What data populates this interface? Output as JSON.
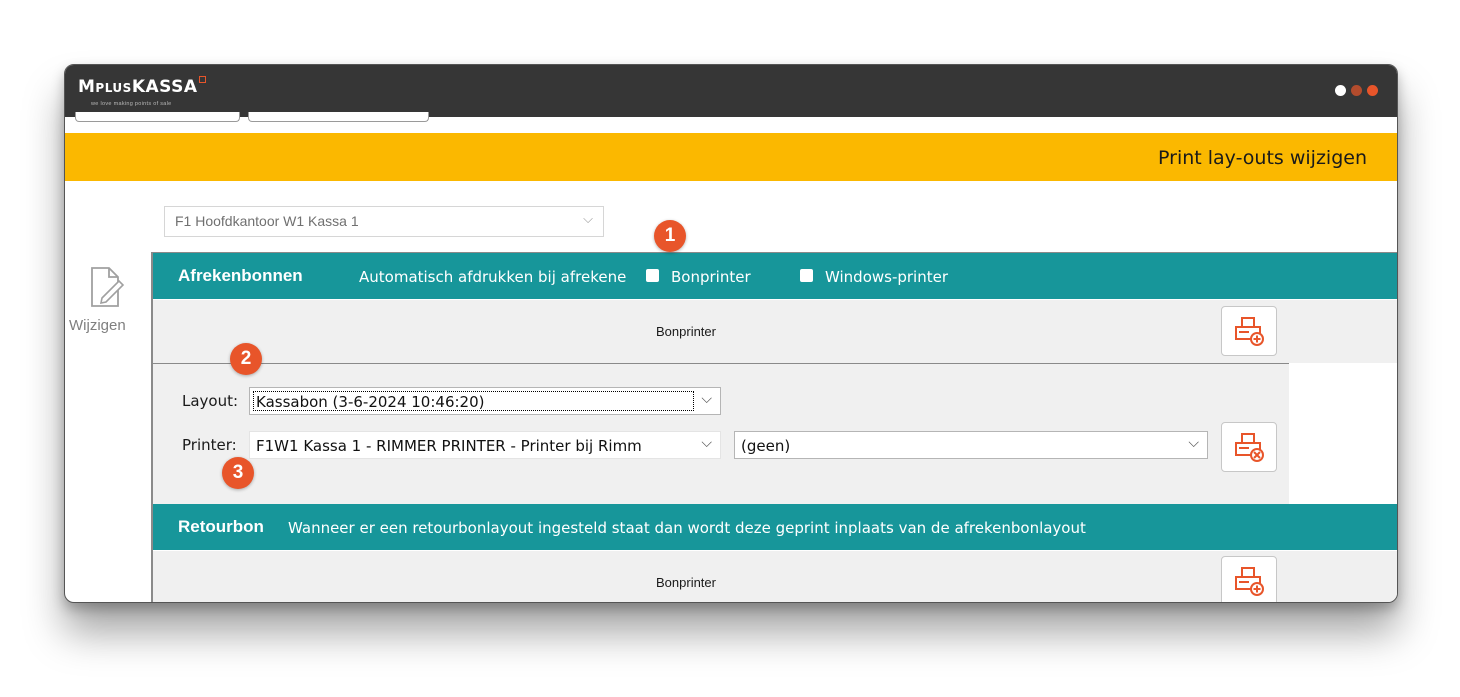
{
  "app": {
    "logo_text": "MPLUSKASSA",
    "tagline": "we love making points of sale",
    "window_dots": [
      "#ffffff",
      "#e8552a",
      "#e8552a"
    ]
  },
  "header": {
    "title": "Print lay-outs wijzigen"
  },
  "store_select": {
    "value": "F1 Hoofdkantoor W1 Kassa 1"
  },
  "sidebar": {
    "edit_label": "Wijzigen"
  },
  "afrekenbonnen": {
    "title": "Afrekenbonnen",
    "auto_print_label": "Automatisch afdrukken bij afrekene",
    "bonprinter_checkbox_label": "Bonprinter",
    "windows_printer_checkbox_label": "Windows-printer",
    "bonprinter_row_label": "Bonprinter",
    "layout_label": "Layout:",
    "layout_value": "Kassabon (3-6-2024 10:46:20)",
    "printer_label": "Printer:",
    "printer_value": "F1W1 Kassa 1 - RIMMER PRINTER - Printer bij Rimm",
    "printer_option_value": "(geen)"
  },
  "retourbon": {
    "title": "Retourbon",
    "description": "Wanneer er een retourbonlayout ingesteld staat dan wordt deze geprint inplaats van de afrekenbonlayout",
    "bonprinter_row_label": "Bonprinter"
  },
  "callouts": [
    "1",
    "2",
    "3"
  ],
  "colors": {
    "accent_orange": "#e8552a",
    "banner_yellow": "#fbb800",
    "teal": "#17969a",
    "titlebar": "#363636"
  }
}
